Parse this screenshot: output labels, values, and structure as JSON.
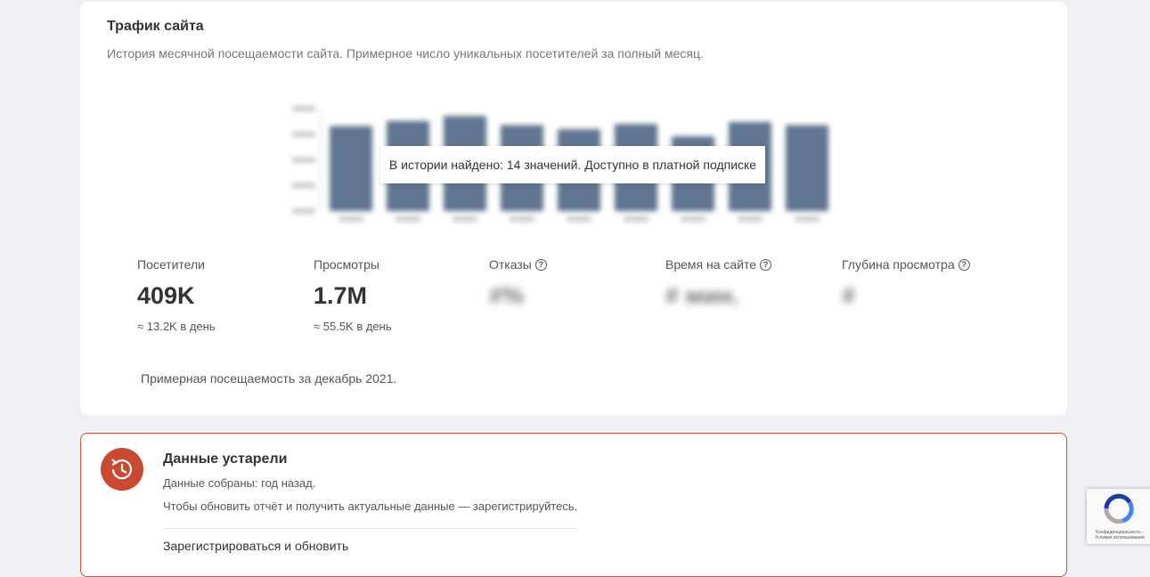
{
  "traffic": {
    "title": "Трафик сайта",
    "subtitle": "История месячной посещаемости сайта. Примерное число уникальных посетителей за полный месяц.",
    "tooltip": "В истории найдено: 14 значений. Доступно в платной подписке",
    "bar_color": "#5f7591",
    "stats": [
      {
        "label": "Посетители",
        "value": "409K",
        "sub": "≈ 13.2K в день",
        "help": false,
        "blurred": false
      },
      {
        "label": "Просмотры",
        "value": "1.7M",
        "sub": "≈ 55.5K в день",
        "help": false,
        "blurred": false
      },
      {
        "label": "Отказы",
        "value": "#%",
        "sub": "",
        "help": true,
        "blurred": true
      },
      {
        "label": "Время на сайте",
        "value": "# мин.",
        "sub": "",
        "help": true,
        "blurred": true
      },
      {
        "label": "Глубина просмотра",
        "value": "#",
        "sub": "",
        "help": true,
        "blurred": true
      }
    ],
    "note": "Примерная посещаемость за декабрь 2021."
  },
  "chart_data": {
    "type": "bar",
    "values": [
      0.83,
      0.88,
      0.93,
      0.84,
      0.8,
      0.85,
      0.73,
      0.87,
      0.84
    ],
    "ylim": [
      0,
      1
    ]
  },
  "outdated": {
    "title": "Данные устарели",
    "line1": "Данные собраны: год назад.",
    "line2": "Чтобы обновить отчёт и получить актуальные данные — зарегистрируйтесь.",
    "link": "Зарегистрироваться и обновить",
    "accent": "#c94a30"
  },
  "recaptcha": {
    "text": "Конфиденциальность - Условия использования"
  }
}
